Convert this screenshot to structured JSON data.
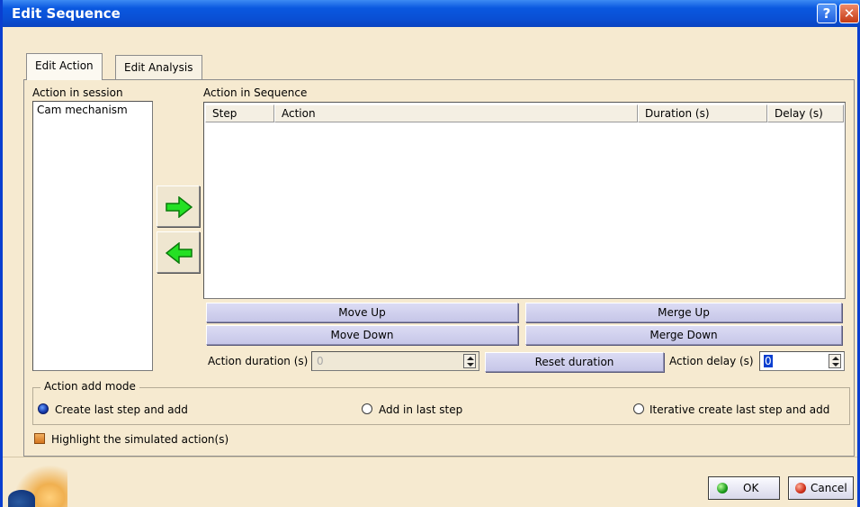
{
  "window": {
    "title": "Edit Sequence",
    "help_icon": "?",
    "close_icon": "✕"
  },
  "tabs": [
    {
      "label": "Edit Action",
      "active": true
    },
    {
      "label": "Edit Analysis",
      "active": false
    }
  ],
  "session": {
    "label": "Action in session",
    "items": [
      "Cam mechanism"
    ]
  },
  "arrows": {
    "add_icon": "arrow-right-icon",
    "remove_icon": "arrow-left-icon",
    "color": "#24e024"
  },
  "sequence": {
    "label": "Action in Sequence",
    "columns": [
      "Step",
      "Action",
      "Duration (s)",
      "Delay (s)"
    ],
    "rows": []
  },
  "buttons": {
    "move_up": "Move Up",
    "move_down": "Move Down",
    "merge_up": "Merge Up",
    "merge_down": "Merge Down",
    "reset_duration": "Reset duration"
  },
  "duration": {
    "label": "Action duration (s)",
    "value": "0"
  },
  "delay": {
    "label": "Action delay (s)",
    "value": "0"
  },
  "add_mode": {
    "legend": "Action add mode",
    "options": [
      {
        "label": "Create last step and add",
        "selected": true
      },
      {
        "label": "Add in last step",
        "selected": false
      },
      {
        "label": "Iterative create last step and add",
        "selected": false
      }
    ]
  },
  "highlight": {
    "label": "Highlight the simulated action(s)",
    "checked": true
  },
  "dialog": {
    "ok": "OK",
    "cancel": "Cancel"
  }
}
